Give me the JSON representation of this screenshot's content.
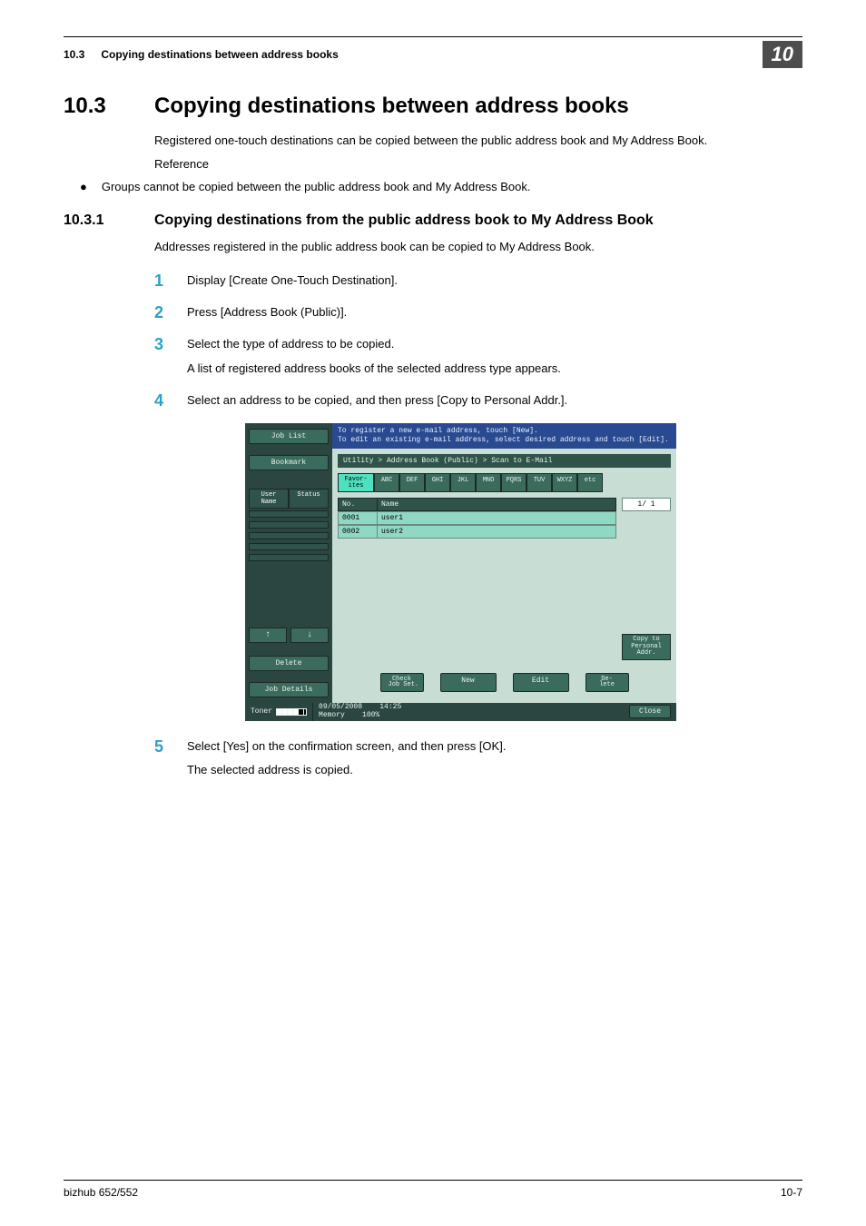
{
  "header": {
    "section_number": "10.3",
    "section_title": "Copying destinations between address books",
    "chapter_badge": "10"
  },
  "h1": {
    "number": "10.3",
    "title": "Copying destinations between address books"
  },
  "intro": {
    "para1": "Registered one-touch destinations can be copied between the public address book and My Address Book.",
    "para2": "Reference",
    "bullet_marker": "●",
    "bullet_text": "Groups cannot be copied between the public address book and My Address Book."
  },
  "h2": {
    "number": "10.3.1",
    "title": "Copying destinations from the public address book to My Address Book"
  },
  "h2_intro": "Addresses registered in the public address book can be copied to My Address Book.",
  "steps": {
    "s1": {
      "num": "1",
      "text": "Display [Create One-Touch Destination]."
    },
    "s2": {
      "num": "2",
      "text": "Press [Address Book (Public)]."
    },
    "s3": {
      "num": "3",
      "text": "Select the type of address to be copied.",
      "sub": "A list of registered address books of the selected address type appears."
    },
    "s4": {
      "num": "4",
      "text": "Select an address to be copied, and then press [Copy to Personal Addr.]."
    },
    "s5": {
      "num": "5",
      "text": "Select [Yes] on the confirmation screen, and then press [OK].",
      "sub": "The selected address is copied."
    }
  },
  "screenshot": {
    "left": {
      "job_list": "Job List",
      "bookmark": "Bookmark",
      "user_name": "User\nName",
      "status": "Status",
      "up": "↑",
      "down": "↓",
      "delete": "Delete",
      "job_details": "Job Details",
      "toner_label": "Toner"
    },
    "banner": {
      "line1": "To register a new e-mail address, touch [New].",
      "line2": "To edit an existing e-mail address, select desired address and touch [Edit]."
    },
    "breadcrumb": "Utility > Address Book (Public) > Scan to E-Mail",
    "tabs": {
      "favor": "Favor-\nites",
      "abc": "ABC",
      "def": "DEF",
      "ghi": "GHI",
      "jkl": "JKL",
      "mno": "MNO",
      "pqrs": "PQRS",
      "tuv": "TUV",
      "wxyz": "WXYZ",
      "etc": "etc"
    },
    "table": {
      "col_no": "No.",
      "col_name": "Name",
      "rows": [
        {
          "no": "0001",
          "name": "user1"
        },
        {
          "no": "0002",
          "name": "user2"
        }
      ]
    },
    "page_indicator": "1/  1",
    "copy_btn": "Copy to\nPersonal\nAddr.",
    "actions": {
      "check": "Check\nJob Set.",
      "new": "New",
      "edit": "Edit",
      "delete": "De-\nlete"
    },
    "footer": {
      "date": "09/05/2008",
      "time": "14:25",
      "memory": "Memory",
      "mem_val": "100%",
      "close": "Close"
    }
  },
  "page_footer": {
    "left": "bizhub 652/552",
    "right": "10-7"
  }
}
